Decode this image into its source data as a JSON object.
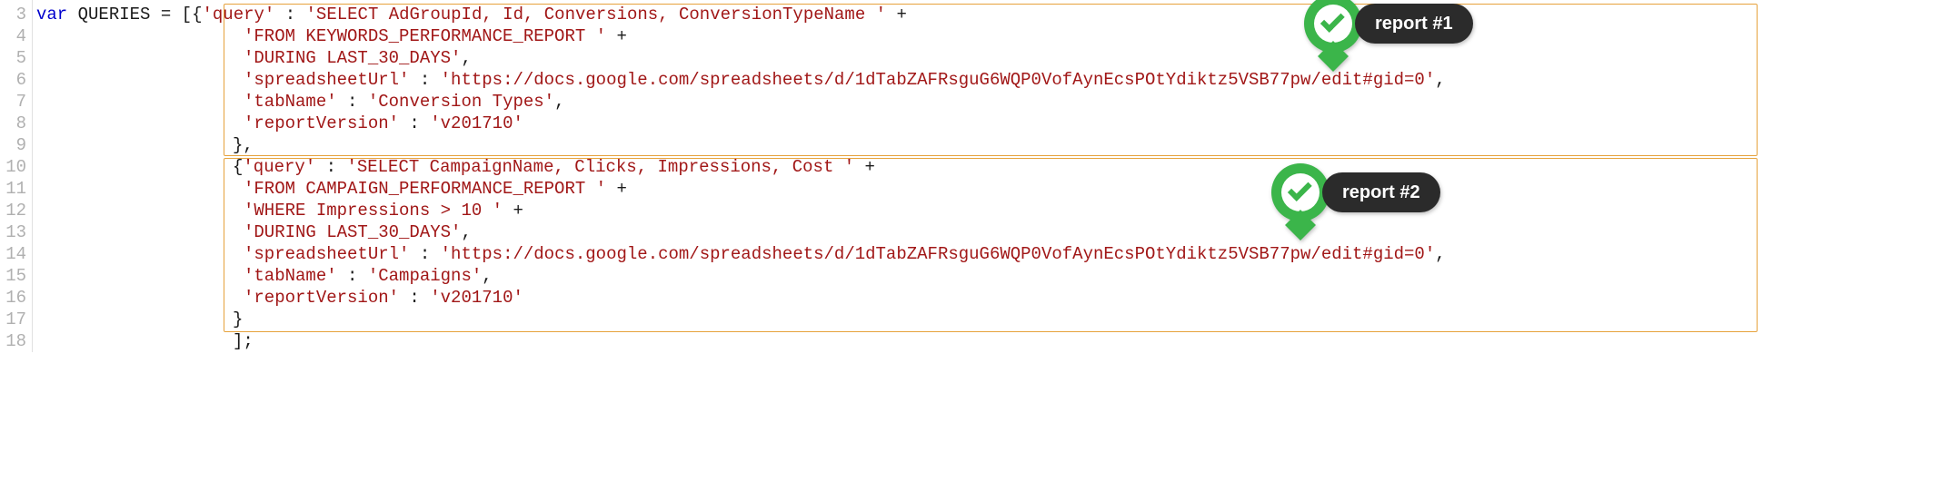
{
  "gutter": {
    "start": 3,
    "end": 18
  },
  "code": {
    "kw_var": "var",
    "ident_queries": "QUERIES",
    "eq": " = ",
    "br_open": "[{",
    "l3_key": "'query'",
    "colon": " : ",
    "l3_str": "'SELECT AdGroupId, Id, Conversions, ConversionTypeName '",
    "plus": " +",
    "l4_str": "'FROM   KEYWORDS_PERFORMANCE_REPORT '",
    "l5_str": "'DURING LAST_30_DAYS'",
    "comma": ",",
    "l6_key": "'spreadsheetUrl'",
    "l6_str": "'https://docs.google.com/spreadsheets/d/1dTabZAFRsguG6WQP0VofAynEcsPOtYdiktz5VSB77pw/edit#gid=0'",
    "l7_key": "'tabName'",
    "l7_str": "'Conversion Types'",
    "l8_key": "'reportVersion'",
    "l8_str": "'v201710'",
    "brace_close_comma": "},",
    "brace_open": "{",
    "l10_key": "'query'",
    "l10_str": "'SELECT CampaignName, Clicks, Impressions, Cost '",
    "l11_str": "'FROM   CAMPAIGN_PERFORMANCE_REPORT '",
    "l12_str": "'WHERE  Impressions > 10 '",
    "l13_str": "'DURING LAST_30_DAYS'",
    "l14_key": "'spreadsheetUrl'",
    "l14_str": "'https://docs.google.com/spreadsheets/d/1dTabZAFRsguG6WQP0VofAynEcsPOtYdiktz5VSB77pw/edit#gid=0'",
    "l15_key": "'tabName'",
    "l15_str": "'Campaigns'",
    "l16_key": "'reportVersion'",
    "l16_str": "'v201710'",
    "brace_close": "}",
    "br_close": "];"
  },
  "callouts": {
    "r1": "report #1",
    "r2": "report #2"
  },
  "colors": {
    "box_border": "#e6a23c",
    "green": "#3bb54a",
    "pill_bg": "#2b2b2b"
  }
}
